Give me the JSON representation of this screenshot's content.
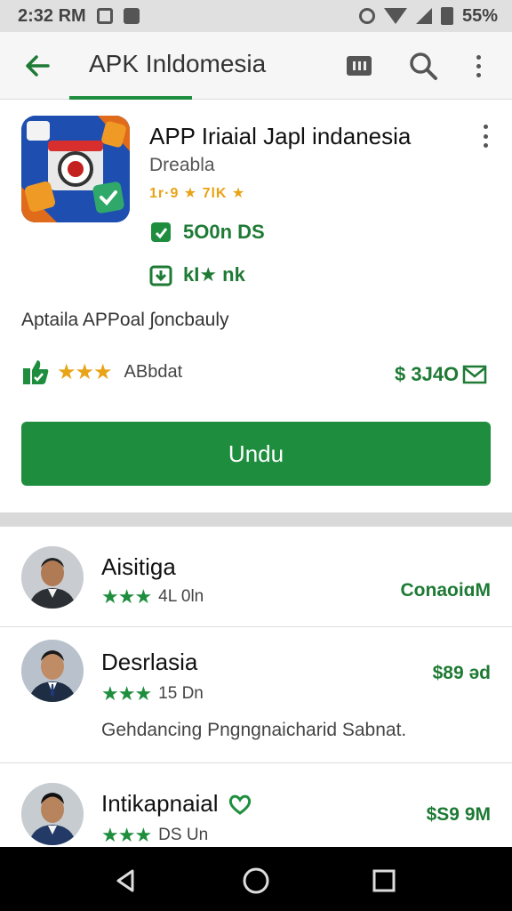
{
  "status_bar": {
    "time": "2:32 RM",
    "battery": "55%"
  },
  "app_bar": {
    "title": "APK Inldomesia"
  },
  "app": {
    "name": "APP Iriaial Japl indanesia",
    "developer": "Dreabla",
    "rating_text": "1r·9 ★ 7lK ★",
    "size": "5O0n DS",
    "downloads": "kI★ nk",
    "description": "Aptaila APPoal ʃoncbauly",
    "stars": "★★★",
    "rating_label": "ABbdat",
    "price": "$ 3J4O",
    "install_label": "Undu"
  },
  "list": [
    {
      "name": "Aisitiga",
      "stars": "★★★",
      "meta": "4L 0ln",
      "price": "ConaoiɑM",
      "description": ""
    },
    {
      "name": "Desrlasia",
      "stars": "★★★",
      "meta": "15 Dn",
      "price": "$89 əd",
      "description": "Gehdancing Pngngnaicharid Sabnat."
    },
    {
      "name": "Intikapnaial",
      "stars": "★★★",
      "meta": "DS Un",
      "price": "$S9 9M",
      "description": ""
    }
  ],
  "colors": {
    "accent": "#1e8e3e",
    "star": "#e8a317"
  },
  "icons": {
    "back": "arrow-left-icon",
    "media": "media-icon",
    "search": "search-icon",
    "more": "more-vert-icon",
    "nav_back": "triangle-back-icon",
    "nav_home": "circle-home-icon",
    "nav_recents": "square-recents-icon"
  }
}
